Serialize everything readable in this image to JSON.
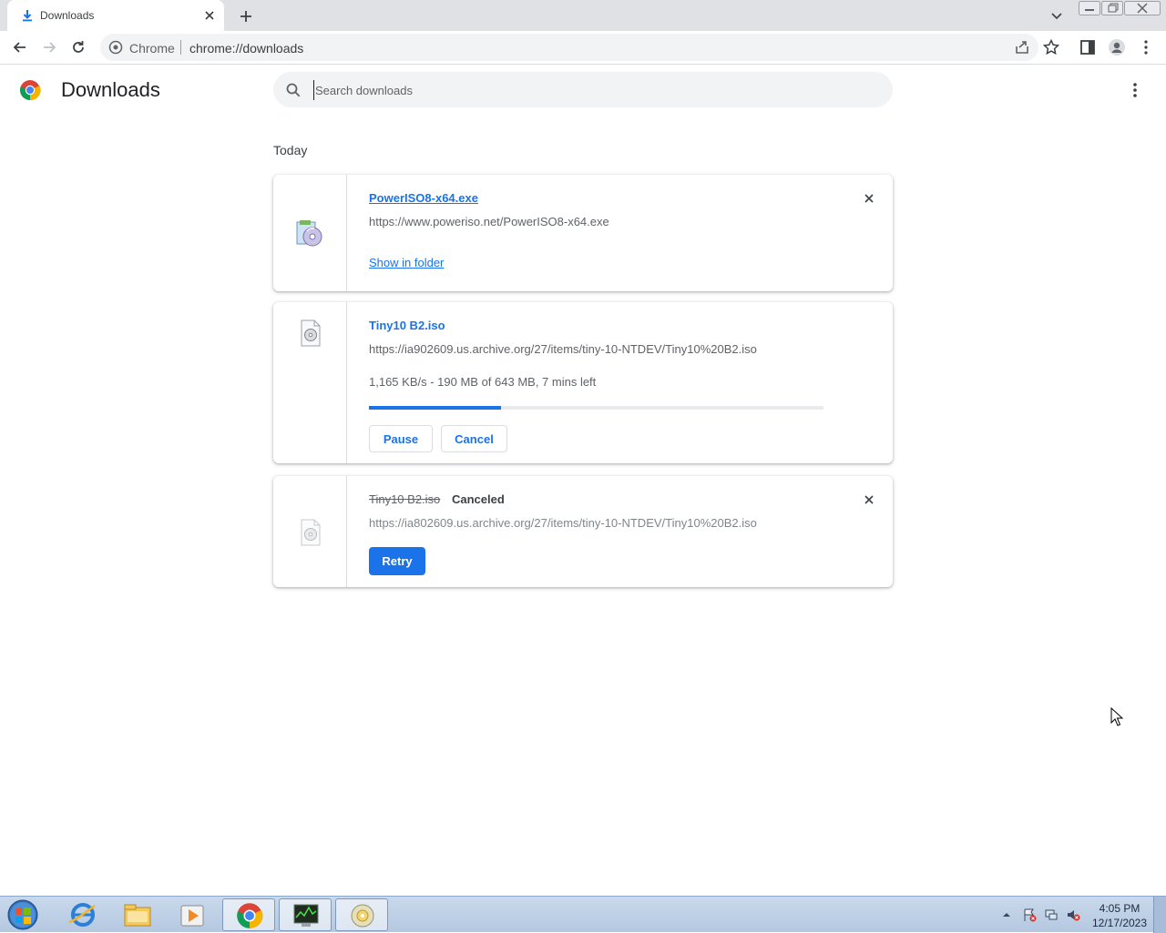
{
  "browser": {
    "tab": {
      "title": "Downloads",
      "icon": "download-icon"
    },
    "omnibox": {
      "site_name": "Chrome",
      "url": "chrome://downloads"
    }
  },
  "page": {
    "title": "Downloads",
    "search": {
      "placeholder": "Search downloads",
      "value": ""
    },
    "section_date": "Today"
  },
  "downloads": [
    {
      "file_name": "PowerISO8-x64.exe",
      "source_url": "https://www.poweriso.net/PowerISO8-x64.exe",
      "action": "Show in folder",
      "icon": "poweriso-app-icon"
    },
    {
      "file_name": "Tiny10 B2.iso",
      "source_url": "https://ia902609.us.archive.org/27/items/tiny-10-NTDEV/Tiny10%20B2.iso",
      "status": "1,165 KB/s - 190 MB of 643 MB, 7 mins left",
      "progress_fraction": 0.29,
      "buttons": [
        "Pause",
        "Cancel"
      ],
      "icon": "disc-image-file-icon"
    },
    {
      "file_name": "Tiny10 B2.iso",
      "state_label": "Canceled",
      "source_url": "https://ia802609.us.archive.org/27/items/tiny-10-NTDEV/Tiny10%20B2.iso",
      "button": "Retry",
      "icon": "disc-image-file-icon"
    }
  ],
  "taskbar": {
    "apps": [
      "internet-explorer-icon",
      "file-explorer-icon",
      "media-player-icon",
      "chrome-icon",
      "task-manager-icon",
      "dvd-drive-icon"
    ],
    "active_app": "chrome-icon",
    "clock_time": "4:05 PM",
    "clock_date": "12/17/2023"
  },
  "colors": {
    "accent": "#1a73e8",
    "toolbar_bg": "#dfe1e5",
    "omnibox_bg": "#f1f3f4"
  }
}
